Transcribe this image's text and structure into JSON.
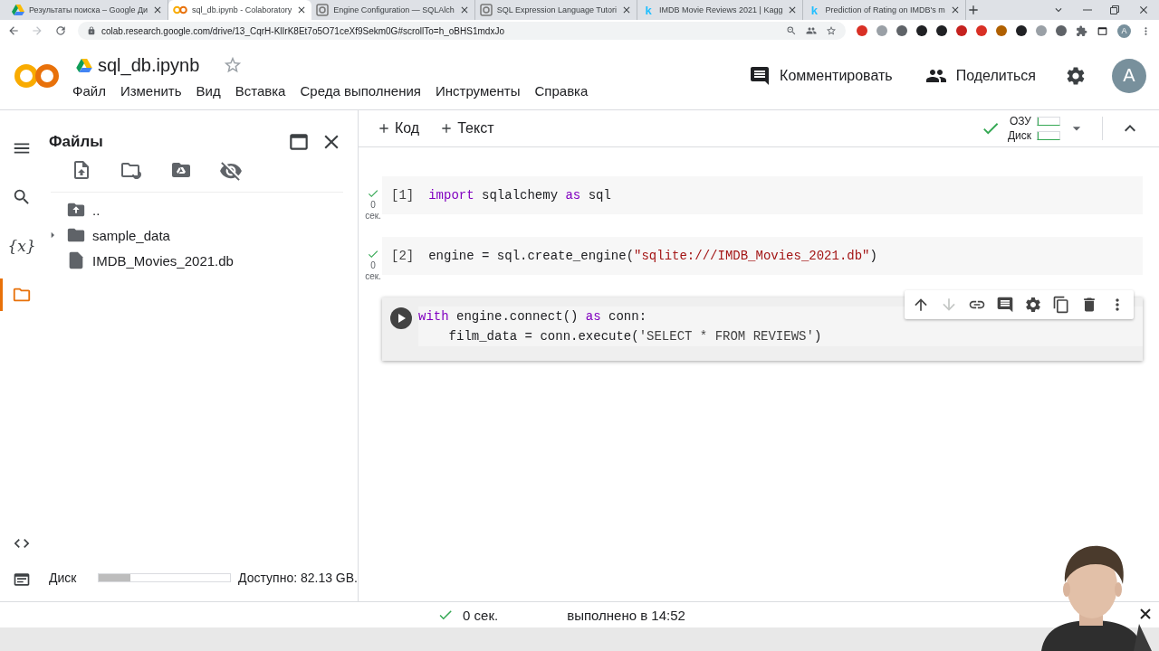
{
  "browser": {
    "tabs": [
      {
        "kind": "drive",
        "title": "Результаты поиска – Google Ди",
        "selected": false
      },
      {
        "kind": "colab",
        "title": "sql_db.ipynb - Colaboratory",
        "selected": true
      },
      {
        "kind": "sqlalchemy",
        "title": "Engine Configuration — SQLAlch",
        "selected": false
      },
      {
        "kind": "sqlalchemy",
        "title": "SQL Expression Language Tutori",
        "selected": false
      },
      {
        "kind": "letter",
        "icon_text": "k",
        "title": "IMDB Movie Reviews 2021 | Kagg",
        "selected": false
      },
      {
        "kind": "letter",
        "icon_text": "k",
        "title": "Prediction of Rating on IMDB's m",
        "selected": false
      }
    ],
    "url": "colab.research.google.com/drive/13_CqrH-KlIrK8Et7o5O71ceXf9Sekm0G#scrollTo=h_oBHS1mdxJo",
    "profile": "A"
  },
  "header": {
    "title": "sql_db.ipynb",
    "starred": false,
    "menu": [
      "Файл",
      "Изменить",
      "Вид",
      "Вставка",
      "Среда выполнения",
      "Инструменты",
      "Справка"
    ],
    "actions": [
      {
        "kind": "comment",
        "label": "Комментировать"
      },
      {
        "kind": "share",
        "label": "Поделиться"
      }
    ],
    "avatar": "A"
  },
  "sidebar": {
    "rail": [
      {
        "kind": "menu",
        "selected": false
      },
      {
        "kind": "search",
        "selected": false
      },
      {
        "kind": "text",
        "text": "{x}",
        "selected": false
      },
      {
        "kind": "folder",
        "selected": true
      }
    ],
    "rail_bottom": [
      {
        "kind": "code"
      },
      {
        "kind": "terminal"
      }
    ],
    "title": "Файлы",
    "files": [
      {
        "kind": "parent",
        "name": ".."
      },
      {
        "kind": "folder",
        "name": "sample_data",
        "expanded": false
      },
      {
        "kind": "file",
        "name": "IMDB_Movies_2021.db"
      }
    ],
    "disk": {
      "label": "Диск",
      "level": 0.24,
      "available": "Доступно: 82.13 GB."
    }
  },
  "toolbar": {
    "add": [
      "Код",
      "Текст"
    ],
    "connected": true,
    "resources": [
      {
        "label": "ОЗУ",
        "level": 0.05
      },
      {
        "label": "Диск",
        "level": 0.05
      }
    ]
  },
  "cells": [
    {
      "count": "[1]",
      "executed": true,
      "time": "0",
      "time_unit": "сек.",
      "focused": false,
      "lines": [
        [
          {
            "kind": "keyword",
            "t": "import"
          },
          {
            "kind": "plain",
            "t": " sqlalchemy "
          },
          {
            "kind": "keyword",
            "t": "as"
          },
          {
            "kind": "plain",
            "t": " sql"
          }
        ]
      ]
    },
    {
      "count": "[2]",
      "executed": true,
      "time": "0",
      "time_unit": "сек.",
      "focused": false,
      "lines": [
        [
          {
            "kind": "plain",
            "t": "engine = sql.create_engine("
          },
          {
            "kind": "string",
            "t": "\"sqlite:///IMDB_Movies_2021.db\""
          },
          {
            "kind": "plain",
            "t": ")"
          }
        ]
      ]
    },
    {
      "executed": false,
      "focused": true,
      "lines": [
        [
          {
            "kind": "keyword",
            "t": "with"
          },
          {
            "kind": "plain",
            "t": " engine.connect() "
          },
          {
            "kind": "keyword",
            "t": "as"
          },
          {
            "kind": "plain",
            "t": " conn:"
          }
        ],
        [
          {
            "kind": "plain",
            "t": "    film_data = conn.execute("
          },
          {
            "kind": "sqlstring",
            "t": "'SELECT * FROM REVIEWS'"
          },
          {
            "kind": "plain",
            "t": ")"
          }
        ]
      ]
    }
  ],
  "cell_toolbar": [
    {
      "kind": "up",
      "disabled": false
    },
    {
      "kind": "down",
      "disabled": true
    },
    {
      "kind": "link",
      "disabled": false
    },
    {
      "kind": "comment",
      "disabled": false
    },
    {
      "kind": "settings",
      "disabled": false
    },
    {
      "kind": "mirror",
      "disabled": false
    },
    {
      "kind": "delete",
      "disabled": false
    },
    {
      "kind": "more",
      "disabled": false
    }
  ],
  "status": {
    "ok": true,
    "duration": "0 сек.",
    "completed": "выполнено в 14:52"
  }
}
